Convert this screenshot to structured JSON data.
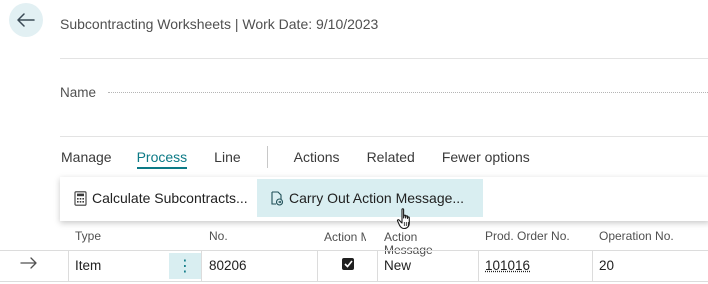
{
  "header": {
    "title": "Subcontracting Worksheets | Work Date: 9/10/2023",
    "back_icon": "arrow-left-icon"
  },
  "fields": {
    "name_label": "Name",
    "name_value": ""
  },
  "actionbar": {
    "items": [
      "Manage",
      "Process",
      "Line",
      "Actions",
      "Related",
      "Fewer options"
    ],
    "active": "Process"
  },
  "process_menu": {
    "items": [
      {
        "label": "Calculate Subcontracts...",
        "icon": "calculator-icon"
      },
      {
        "label": "Carry Out Action Message...",
        "icon": "document-action-icon"
      }
    ],
    "highlighted": "Carry Out Action Message..."
  },
  "grid": {
    "columns": [
      "Type",
      "No.",
      "Action Mess...",
      "Action Message",
      "Prod. Order No.",
      "Operation No."
    ],
    "rows": [
      {
        "type": "Item",
        "no": "80206",
        "accept_action_message": true,
        "action_message": "New",
        "prod_order_no": "101016",
        "operation_no": "20"
      }
    ]
  },
  "colors": {
    "accent": "#0c7a86",
    "highlight": "#d9eef1",
    "back_button_bg": "#e2f0f3"
  }
}
